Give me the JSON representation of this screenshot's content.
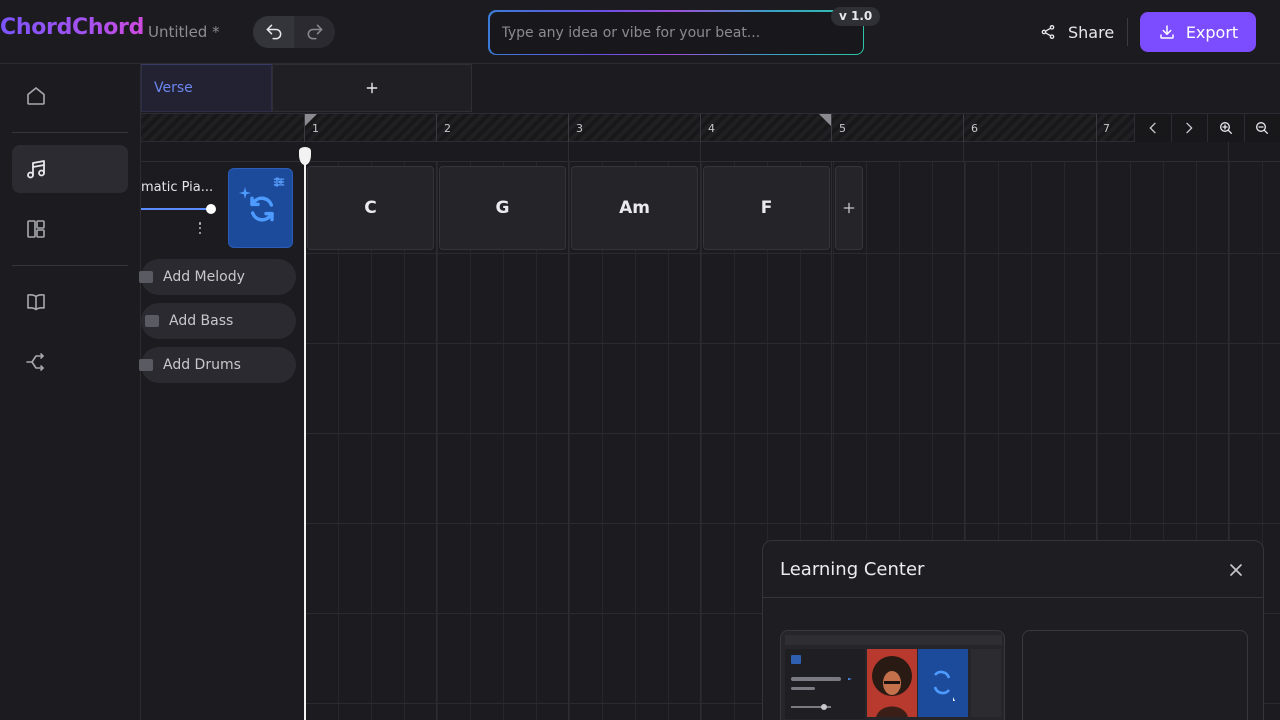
{
  "app": {
    "logo": "ChordChord",
    "doc_title": "Untitled *"
  },
  "prompt": {
    "placeholder": "Type any idea or vibe for your beat...",
    "version": "v 1.0"
  },
  "header_actions": {
    "share_label": "Share",
    "export_label": "Export"
  },
  "sidebar": {
    "items": [
      {
        "icon": "home-icon"
      },
      {
        "icon": "music-note-icon",
        "active": true
      },
      {
        "icon": "layout-icon"
      },
      {
        "icon": "book-icon"
      },
      {
        "icon": "share-flow-icon"
      }
    ]
  },
  "sections": {
    "tabs": [
      {
        "label": "Verse",
        "active": true
      }
    ],
    "add_label": "+"
  },
  "ruler": {
    "bars": [
      "1",
      "2",
      "3",
      "4",
      "5",
      "6",
      "7"
    ]
  },
  "track": {
    "instrument_name": "matic Pia...",
    "volume": 0.94
  },
  "add_tracks": [
    {
      "label": "Add Melody"
    },
    {
      "label": "Add Bass"
    },
    {
      "label": "Add Drums"
    }
  ],
  "chords": [
    "C",
    "G",
    "Am",
    "F"
  ],
  "learning_center": {
    "title": "Learning Center"
  },
  "colors": {
    "accent": "#7c4dff",
    "instrument_tile": "#1d4b9c",
    "section_tab_text": "#6c86f0"
  }
}
